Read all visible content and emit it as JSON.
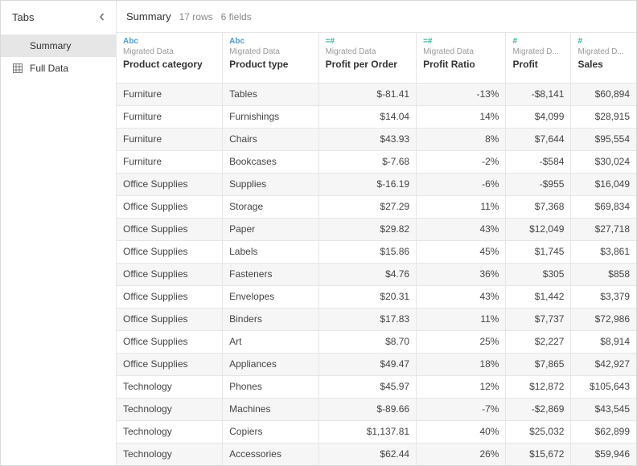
{
  "sidebar": {
    "title": "Tabs",
    "items": [
      {
        "label": "Summary",
        "icon": "",
        "active": true
      },
      {
        "label": "Full Data",
        "icon": "grid",
        "active": false
      }
    ]
  },
  "header": {
    "title": "Summary",
    "rows_label": "17 rows",
    "fields_label": "6 fields"
  },
  "columns": [
    {
      "type_icon": "Abc",
      "type_class": "type-abc",
      "source": "Migrated Data",
      "name": "Product category",
      "align": "left"
    },
    {
      "type_icon": "Abc",
      "type_class": "type-abc",
      "source": "Migrated Data",
      "name": "Product type",
      "align": "left"
    },
    {
      "type_icon": "=#",
      "type_class": "type-num",
      "source": "Migrated Data",
      "name": "Profit per Order",
      "align": "right"
    },
    {
      "type_icon": "=#",
      "type_class": "type-num",
      "source": "Migrated Data",
      "name": "Profit Ratio",
      "align": "right"
    },
    {
      "type_icon": "#",
      "type_class": "type-num",
      "source": "Migrated D...",
      "name": "Profit",
      "align": "right"
    },
    {
      "type_icon": "#",
      "type_class": "type-num",
      "source": "Migrated D...",
      "name": "Sales",
      "align": "right"
    }
  ],
  "rows": [
    [
      "Furniture",
      "Tables",
      "$-81.41",
      "-13%",
      "-$8,141",
      "$60,894"
    ],
    [
      "Furniture",
      "Furnishings",
      "$14.04",
      "14%",
      "$4,099",
      "$28,915"
    ],
    [
      "Furniture",
      "Chairs",
      "$43.93",
      "8%",
      "$7,644",
      "$95,554"
    ],
    [
      "Furniture",
      "Bookcases",
      "$-7.68",
      "-2%",
      "-$584",
      "$30,024"
    ],
    [
      "Office Supplies",
      "Supplies",
      "$-16.19",
      "-6%",
      "-$955",
      "$16,049"
    ],
    [
      "Office Supplies",
      "Storage",
      "$27.29",
      "11%",
      "$7,368",
      "$69,834"
    ],
    [
      "Office Supplies",
      "Paper",
      "$29.82",
      "43%",
      "$12,049",
      "$27,718"
    ],
    [
      "Office Supplies",
      "Labels",
      "$15.86",
      "45%",
      "$1,745",
      "$3,861"
    ],
    [
      "Office Supplies",
      "Fasteners",
      "$4.76",
      "36%",
      "$305",
      "$858"
    ],
    [
      "Office Supplies",
      "Envelopes",
      "$20.31",
      "43%",
      "$1,442",
      "$3,379"
    ],
    [
      "Office Supplies",
      "Binders",
      "$17.83",
      "11%",
      "$7,737",
      "$72,986"
    ],
    [
      "Office Supplies",
      "Art",
      "$8.70",
      "25%",
      "$2,227",
      "$8,914"
    ],
    [
      "Office Supplies",
      "Appliances",
      "$49.47",
      "18%",
      "$7,865",
      "$42,927"
    ],
    [
      "Technology",
      "Phones",
      "$45.97",
      "12%",
      "$12,872",
      "$105,643"
    ],
    [
      "Technology",
      "Machines",
      "$-89.66",
      "-7%",
      "-$2,869",
      "$43,545"
    ],
    [
      "Technology",
      "Copiers",
      "$1,137.81",
      "40%",
      "$25,032",
      "$62,899"
    ],
    [
      "Technology",
      "Accessories",
      "$62.44",
      "26%",
      "$15,672",
      "$59,946"
    ]
  ]
}
